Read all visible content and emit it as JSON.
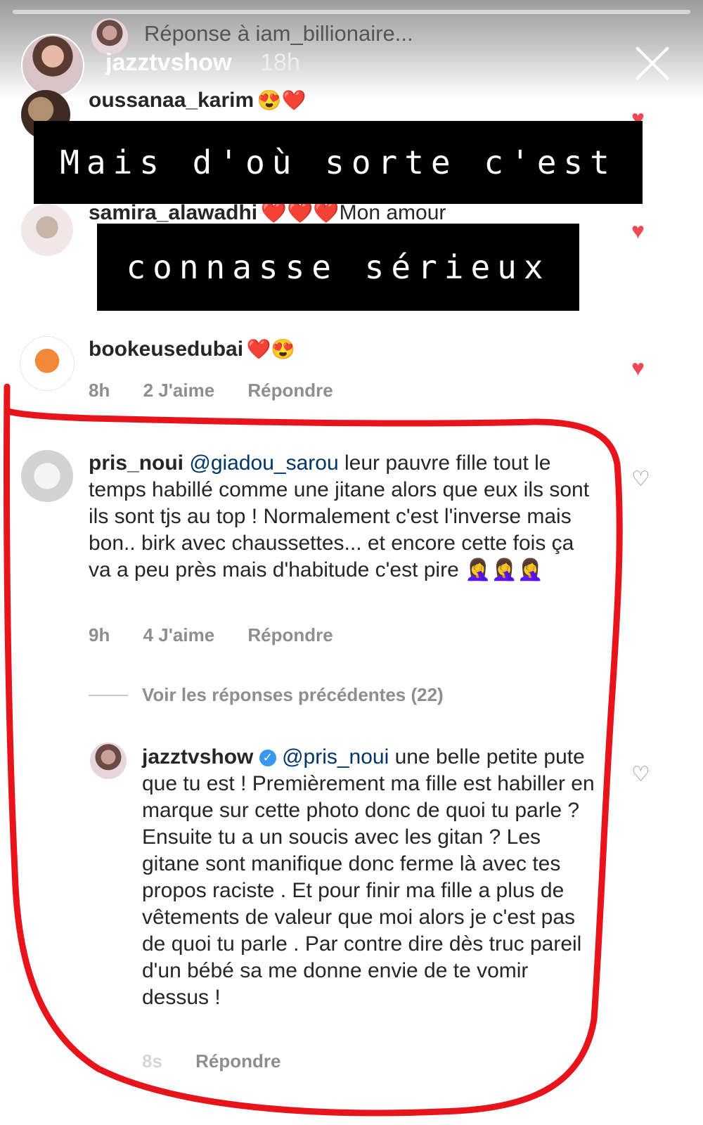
{
  "story": {
    "reply_to": "Réponse à iam_billionaire...",
    "user": "jazztvshow",
    "time": "18h"
  },
  "comments": [
    {
      "user": "oussanaa_karim",
      "emoji": "😍❤️"
    },
    {
      "user": "samira_alawadhi",
      "text": "❤️❤️❤️Mon amour"
    },
    {
      "user": "bookeusedubai",
      "emoji": "❤️😍",
      "time": "8h",
      "likes": "2 J'aime",
      "reply": "Répondre"
    }
  ],
  "overlay": {
    "line1": "Mais d'où sorte c'est",
    "line2": "connasse sérieux"
  },
  "main_comment": {
    "user": "pris_noui",
    "mention": "@giadou_sarou",
    "text": " leur pauvre fille tout le temps habillé comme une jitane alors que eux ils sont ils sont tjs au top ! Normalement c'est l'inverse mais bon.. birk avec chaussettes... et encore cette fois ça va a peu près mais d'habitude c'est pire 🤦‍♀️🤦‍♀️🤦‍♀️",
    "time": "9h",
    "likes": "4 J'aime",
    "reply": "Répondre"
  },
  "view_replies": "Voir les réponses précédentes (22)",
  "reply_comment": {
    "user": "jazztvshow",
    "mention": "@pris_noui",
    "text": " une belle petite pute que tu est ! Premièrement ma fille est habiller en marque sur cette photo donc de quoi tu parle ? Ensuite tu a un soucis avec les gitan ? Les gitane sont manifique donc ferme là avec tes propos raciste . Et pour finir ma fille a plus de vêtements de valeur que moi alors je c'est pas de quoi tu parle . Par contre dire dès truc pareil d'un bébé sa me donne envie de te vomir dessus !",
    "time": "8s",
    "reply": "Répondre"
  },
  "colors": {
    "highlight_outline": "#e8141c",
    "like_red": "#ed4956",
    "meta_gray": "#8e8e8e"
  }
}
